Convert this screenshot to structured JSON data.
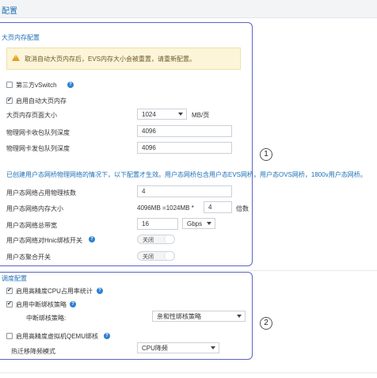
{
  "header": {
    "title": "配置"
  },
  "hugepage": {
    "section_title": "大页内存配置",
    "warning": "取消自动大页内存后，EVS内存大小会被重置，请重新配置。",
    "third_party_vswitch": "第三方vSwitch",
    "enable_auto_hugepage": "启用自动大页内存",
    "page_size_label": "大页内存页面大小",
    "page_size_value": "1024",
    "page_size_unit": "MB/页",
    "rx_queue_label": "物理网卡收包队列深度",
    "rx_queue_value": "4096",
    "tx_queue_label": "物理网卡发包队列深度",
    "tx_queue_value": "4096"
  },
  "userspace": {
    "info": "已创建用户态网桥物理网络的情况下，以下配置才生效。用户态网桥包含用户态EVS网桥，用户态OVS网桥，1800v用户态网桥。",
    "cores_label": "用户态网络占用物理核数",
    "cores_value": "4",
    "memory_label": "用户态网络内存大小",
    "memory_text": "4096MB  =1024MB *",
    "memory_multiplier": "4",
    "memory_unit": "倍数",
    "bandwidth_label": "用户态网络总带宽",
    "bandwidth_value": "16",
    "bandwidth_unit": "Gbps",
    "hnic_label": "用户态网络对Hnic绑核开关",
    "hnic_state": "关闭",
    "aggregate_label": "用户态聚合开关",
    "aggregate_state": "关闭"
  },
  "scheduling": {
    "section_title": "调度配置",
    "cpu_stats": "启用高精度CPU占用率统计",
    "interrupt_binding": "启用中断绑核策略",
    "interrupt_policy_label": "中断绑核策略:",
    "interrupt_policy_value": "亲和性绑核策略",
    "qemu_binding": "启用高精度虚拟机QEMU绑核",
    "hot_migration_label": "热迁移降频模式",
    "hot_migration_value": "CPU降频"
  },
  "callouts": {
    "first": "1",
    "second": "2"
  },
  "colors": {
    "frame": "#5a63c7",
    "accent": "#1d6fb6",
    "warning_bg": "#fdf5d9",
    "help": "#2d7fd2"
  }
}
